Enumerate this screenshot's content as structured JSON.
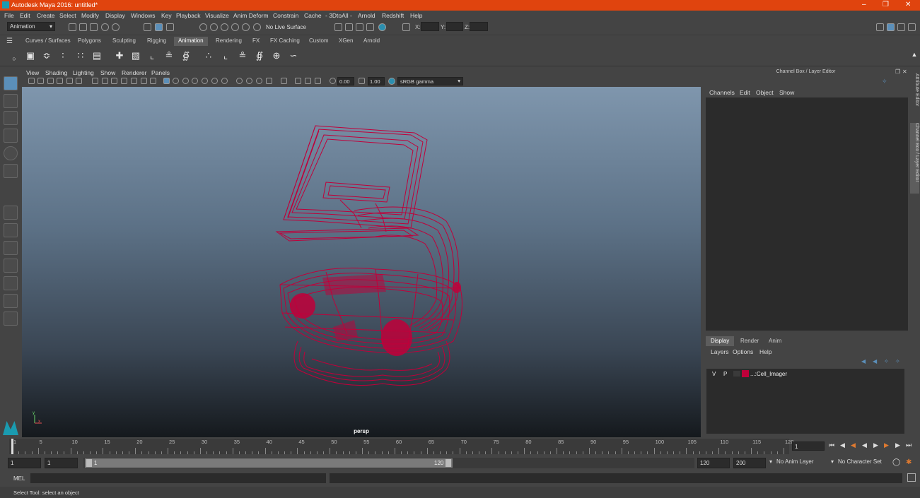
{
  "app": {
    "title": "Autodesk Maya 2016: untitled*"
  },
  "menubar": [
    "File",
    "Edit",
    "Create",
    "Select",
    "Modify",
    "Display",
    "Windows",
    "Key",
    "Playback",
    "Visualize",
    "Anim Deform",
    "Constrain",
    "Cache",
    "- 3DtoAll -",
    "Arnold",
    "Redshift",
    "Help"
  ],
  "statusline": {
    "mode": "Animation",
    "live_surface": "No Live Surface",
    "x_label": "X:",
    "y_label": "Y:",
    "z_label": "Z:"
  },
  "shelf_tabs": [
    "Curves / Surfaces",
    "Polygons",
    "Sculpting",
    "Rigging",
    "Animation",
    "Rendering",
    "FX",
    "FX Caching",
    "Custom",
    "XGen",
    "Arnold"
  ],
  "shelf_active": "Animation",
  "viewport": {
    "menu": [
      "View",
      "Shading",
      "Lighting",
      "Show",
      "Renderer",
      "Panels"
    ],
    "exposure": "0.00",
    "gamma": "1.00",
    "colorspace": "sRGB gamma",
    "camera": "persp",
    "wire_color": "#c0003a",
    "axis_y": "y",
    "axis_x": "x"
  },
  "channel_box": {
    "title": "Channel Box / Layer Editor",
    "menu": [
      "Channels",
      "Edit",
      "Object",
      "Show"
    ]
  },
  "layer_editor": {
    "tabs": [
      "Display",
      "Render",
      "Anim"
    ],
    "active_tab": "Display",
    "menu": [
      "Layers",
      "Options",
      "Help"
    ],
    "layer": {
      "v": "V",
      "p": "P",
      "name": "...:Cell_Imager",
      "color": "#c0003a"
    }
  },
  "side_tabs": [
    "Attribute Editor",
    "Channel Box / Layer Editor"
  ],
  "timeline": {
    "ticks": [
      "1",
      "5",
      "10",
      "15",
      "20",
      "25",
      "30",
      "35",
      "40",
      "45",
      "50",
      "55",
      "60",
      "65",
      "70",
      "75",
      "80",
      "85",
      "90",
      "95",
      "100",
      "105",
      "110",
      "115",
      "120"
    ],
    "current_frame": "1"
  },
  "range": {
    "start": "1",
    "playback_start": "1",
    "slider_start": "1",
    "slider_end": "120",
    "playback_end": "120",
    "end": "200",
    "anim_layer": "No Anim Layer",
    "character_set": "No Character Set"
  },
  "command_line": {
    "label": "MEL"
  },
  "help_line": "Select Tool: select an object"
}
